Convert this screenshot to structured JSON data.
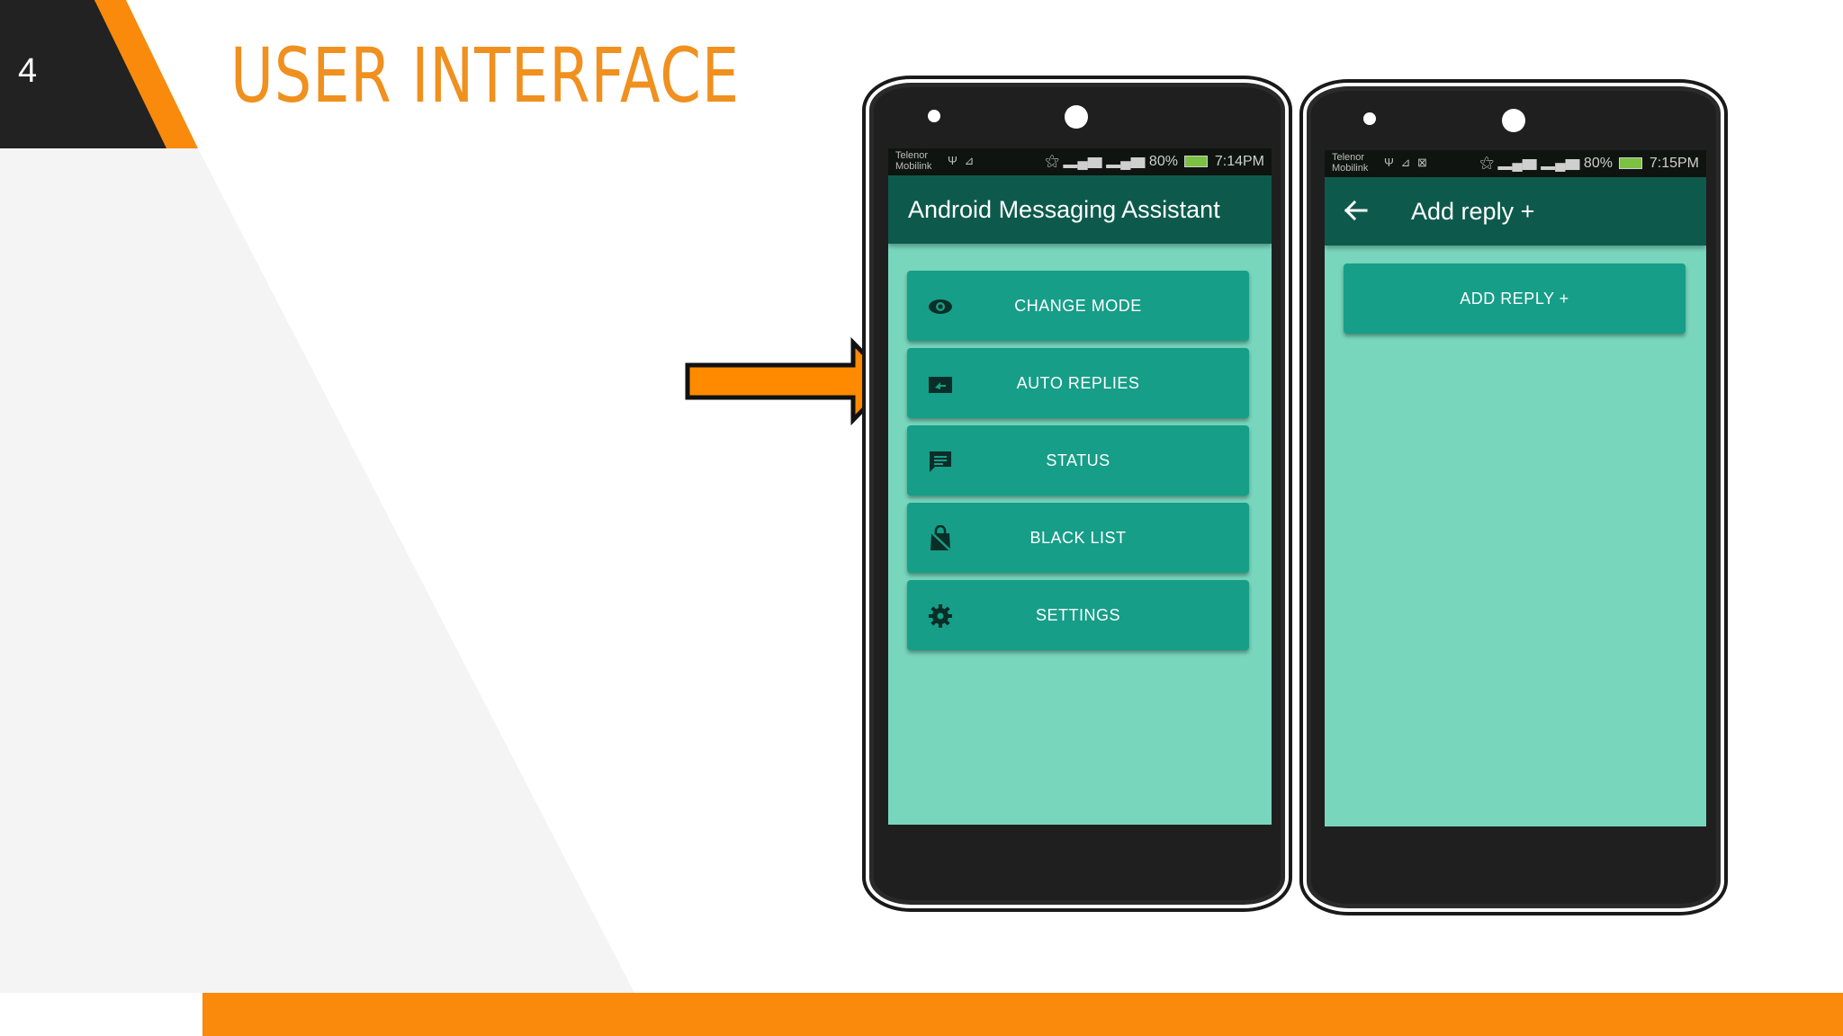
{
  "slide": {
    "number": "4",
    "title": "USER INTERFACE"
  },
  "colors": {
    "accent_orange": "#f98a0b",
    "title_orange": "#f0901f",
    "dark_block": "#222222",
    "app_bar": "#0d5a4c",
    "button_teal": "#169e88",
    "screen_mint": "#78d6bd"
  },
  "phone_left": {
    "status": {
      "carrier": "Telenor Mobilink",
      "right": "80%",
      "time": "7:14PM"
    },
    "app_title": "Android Messaging Assistant",
    "buttons": [
      {
        "label": "CHANGE MODE",
        "icon": "eye-icon"
      },
      {
        "label": "AUTO REPLIES",
        "icon": "reply-icon"
      },
      {
        "label": "STATUS",
        "icon": "chat-icon"
      },
      {
        "label": "BLACK LIST",
        "icon": "blocked-bag-icon"
      },
      {
        "label": "SETTINGS",
        "icon": "gear-icon"
      }
    ]
  },
  "phone_right": {
    "status": {
      "carrier": "Telenor Mobilink",
      "right": "80%",
      "time": "7:15PM"
    },
    "app_title": "Add reply +",
    "buttons": [
      {
        "label": "ADD REPLY +"
      }
    ]
  },
  "pointer": {
    "icon": "arrow-right-icon",
    "points_to": "AUTO REPLIES"
  }
}
